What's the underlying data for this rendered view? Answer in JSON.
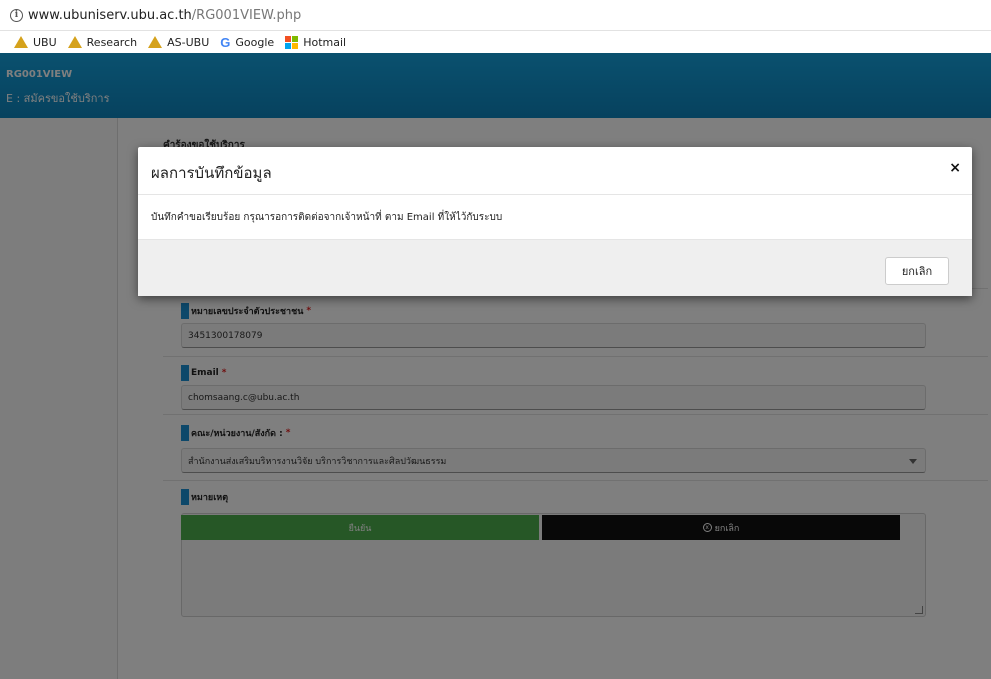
{
  "browser": {
    "info_glyph": "i",
    "url_host": "www.ubuniserv.ubu.ac.th",
    "url_path": "/RG001VIEW.php",
    "bookmarks": [
      {
        "label": "UBU",
        "icon": "ubu-logo-icon"
      },
      {
        "label": "Research",
        "icon": "ubu-logo-icon"
      },
      {
        "label": "AS-UBU",
        "icon": "ubu-logo-icon"
      },
      {
        "label": "Google",
        "icon": "google-icon"
      },
      {
        "label": "Hotmail",
        "icon": "windows-icon"
      }
    ],
    "google_glyph": "G"
  },
  "header": {
    "code": "RG001VIEW",
    "subtitle": "E : สมัครขอใช้บริการ"
  },
  "form": {
    "title": "คำร้องขอใช้บริการ",
    "id_label": "หมายเลขประจำตัวประชาชน",
    "id_value": "3451300178079",
    "email_label": "Email",
    "email_value": "chomsaang.c@ubu.ac.th",
    "unit_label": "คณะ/หน่วยงาน/สังกัด :",
    "unit_value": "สำนักงานส่งเสริมบริหารงานวิจัย บริการวิชาการและศิลปวัฒนธรรม",
    "note_label": "หมายเหตุ",
    "required_mark": "*",
    "confirm_label": "ยืนยัน",
    "cancel_label": "ยกเลิก",
    "cancel_glyph": "x"
  },
  "modal": {
    "title": "ผลการบันทึกข้อมูล",
    "close_glyph": "×",
    "message": "บันทึกคำขอเรียบร้อย กรุณารอการติดต่อจากเจ้าหน้าที่ ตาม Email ที่ให้ไว้กับระบบ",
    "button_label": "ยกเลิก"
  }
}
